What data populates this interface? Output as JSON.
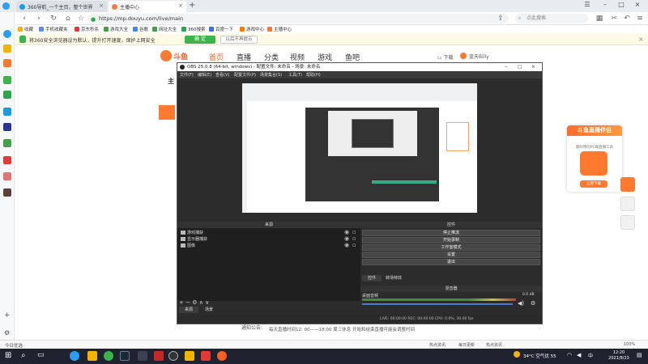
{
  "browser": {
    "tabs": [
      {
        "label": "360导航_一个主页，整个世界",
        "color": "#1a9be6"
      },
      {
        "label": "主播中心",
        "color": "#ff7a2e"
      }
    ],
    "new_tab": "+",
    "url": "https://mp.douyu.com/live/main",
    "search_placeholder": "点此搜索"
  },
  "bookmarks": [
    {
      "label": "收藏",
      "color": "#f5b400"
    },
    {
      "label": "手机收藏夹",
      "color": "#5b8def"
    },
    {
      "label": "京东秒杀",
      "color": "#e53935"
    },
    {
      "label": "游戏大全",
      "color": "#43a047"
    },
    {
      "label": "谷歌",
      "color": "#4285f4"
    },
    {
      "label": "网址大全",
      "color": "#43a047"
    },
    {
      "label": "360搜索",
      "color": "#2aa74a"
    },
    {
      "label": "百度一下",
      "color": "#3b6cf5"
    },
    {
      "label": "游戏中心",
      "color": "#f57c00"
    },
    {
      "label": "主播中心",
      "color": "#ff7a2e"
    }
  ],
  "notice": {
    "text": "将360安全浏览器设为默认，提升打开速度，保护上网安全",
    "confirm": "确 定",
    "dismiss": "以后不再提示"
  },
  "douyu": {
    "logo": "斗鱼",
    "nav": [
      "首页",
      "直播",
      "分类",
      "视频",
      "游戏",
      "鱼吧"
    ],
    "download": "下载",
    "user": "蓝天Billy",
    "left_tab": "主",
    "promo": {
      "title": "斗鱼直播伴侣",
      "subtitle": "最好用的PC端直播工具",
      "button": "立即下载"
    },
    "notice_label": "通知公告:",
    "notice_text": "每天直播时间12: 00——18:00 周三休息 开始和结束直播可能会调整时间"
  },
  "obs": {
    "title": "OBS 25.0.8 (64-bit, windows) - 配置文件: 未命名 - 场景: 未命名",
    "menu": [
      "文件(F)",
      "编辑(E)",
      "查看(V)",
      "配置文件(P)",
      "场景集合(S)",
      "工具(T)",
      "帮助(H)"
    ],
    "sources_header": "来源",
    "sources": [
      "游戏捕获",
      "显示器捕获",
      "图像"
    ],
    "controls_header": "控件",
    "controls": [
      "停止推流",
      "开始录制",
      "工作室模式",
      "设置",
      "退出"
    ],
    "tabs": [
      "控件",
      "转场特效"
    ],
    "mixer_header": "混音器",
    "mixer_item": "桌面音频",
    "mixer_db": "0.0 dB",
    "bottom_tabs": [
      "来源",
      "场景"
    ],
    "status": "LIVE: 00:00:00   REC: 00:00:00   CPU: 0.9%, 30.00 fps"
  },
  "status_bar": {
    "left": "今日优选",
    "items": [
      "热点资讯",
      "每日更新",
      "热点资讯"
    ],
    "zoom": "100%"
  },
  "taskbar": {
    "weather": "34°C 空气优 55",
    "time": "12:20",
    "date": "2021/8/23"
  }
}
